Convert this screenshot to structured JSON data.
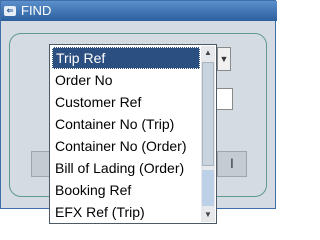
{
  "window": {
    "title": "FIND"
  },
  "panel": {
    "right_button_label": "l"
  },
  "dropdown": {
    "selected": "Trip Ref",
    "options": [
      "Trip Ref",
      "Order No",
      "Customer Ref",
      "Container No (Trip)",
      "Container No (Order)",
      "Bill of Lading (Order)",
      "Booking Ref",
      "EFX Ref (Trip)"
    ]
  },
  "icons": {
    "title_icon": "app-window-icon",
    "combo_arrow": "chevron-down-icon",
    "scroll_up": "arrow-up-icon",
    "scroll_down": "arrow-down-icon"
  },
  "colors": {
    "titlebar": "#2b5f9e",
    "selection": "#2c4f82",
    "panel_border": "#5f9a8a"
  }
}
